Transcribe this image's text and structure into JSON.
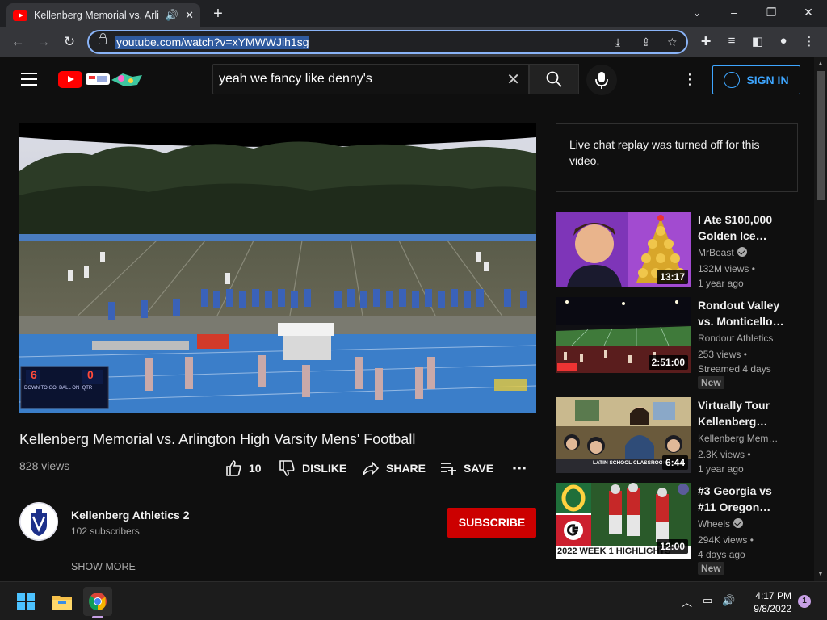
{
  "browser": {
    "tab_title": "Kellenberg Memorial vs. Arlin",
    "url": "youtube.com/watch?v=xYMWWJih1sg"
  },
  "masthead": {
    "search_query": "yeah we fancy like denny's",
    "sign_in_label": "SIGN IN"
  },
  "video": {
    "title": "Kellenberg Memorial vs. Arlington High Varsity Mens' Football",
    "views": "828 views",
    "like_count": "10",
    "dislike_label": "DISLIKE",
    "share_label": "SHARE",
    "save_label": "SAVE",
    "scoreboard": {
      "home": "6",
      "away": "0",
      "labels": "DOWN TO GO  BALL ON  QTR"
    }
  },
  "channel": {
    "name": "Kellenberg Athletics 2",
    "subscribers": "102 subscribers",
    "subscribe_label": "SUBSCRIBE",
    "show_more_label": "SHOW MORE"
  },
  "chat": {
    "message": "Live chat replay was turned off for this video."
  },
  "related": [
    {
      "title": "I Ate $100,000 Golden Ice…",
      "channel": "MrBeast",
      "verified": true,
      "views": "132M views •",
      "age": "1 year ago",
      "duration": "13:17",
      "badge": ""
    },
    {
      "title": "Rondout Valley vs. Monticello…",
      "channel": "Rondout Athletics",
      "verified": false,
      "views": "253 views •",
      "age": "Streamed 4 days",
      "duration": "2:51:00",
      "badge": "New"
    },
    {
      "title": "Virtually Tour Kellenberg…",
      "channel": "Kellenberg Mem…",
      "verified": false,
      "views": "2.3K views •",
      "age": "1 year ago",
      "duration": "6:44",
      "badge": "",
      "thumb_caption": "LATIN SCHOOL CLASSROOM"
    },
    {
      "title": "#3 Georgia vs #11 Oregon…",
      "channel": "Wheels",
      "verified": true,
      "views": "294K views •",
      "age": "4 days ago",
      "duration": "12:00",
      "badge": "New",
      "thumb_caption": "2022 WEEK 1 HIGHLIGHTS"
    }
  ],
  "taskbar": {
    "time": "4:17 PM",
    "date": "9/8/2022",
    "notifications": "1"
  },
  "colors": {
    "youtube_red": "#ff0000",
    "subscribe_red": "#cc0000",
    "link_blue": "#3ea6ff",
    "background": "#0f0f0f"
  }
}
